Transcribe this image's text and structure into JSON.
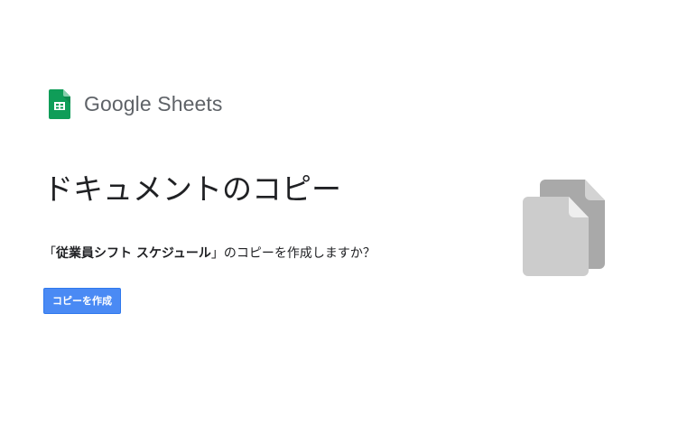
{
  "brand": {
    "logo_icon": "google-sheets-icon",
    "name": "Google Sheets",
    "accent_color": "#0f9d58"
  },
  "page": {
    "title": "ドキュメントのコピー",
    "prompt_open_quote": "「",
    "document_name": "従業員シフト スケジュール",
    "prompt_close_quote": "」",
    "prompt_suffix": "のコピーを作成しますか？"
  },
  "actions": {
    "make_copy_label": "コピーを作成",
    "button_color": "#4a8af4"
  },
  "illustration": {
    "icon": "copy-documents-icon"
  }
}
